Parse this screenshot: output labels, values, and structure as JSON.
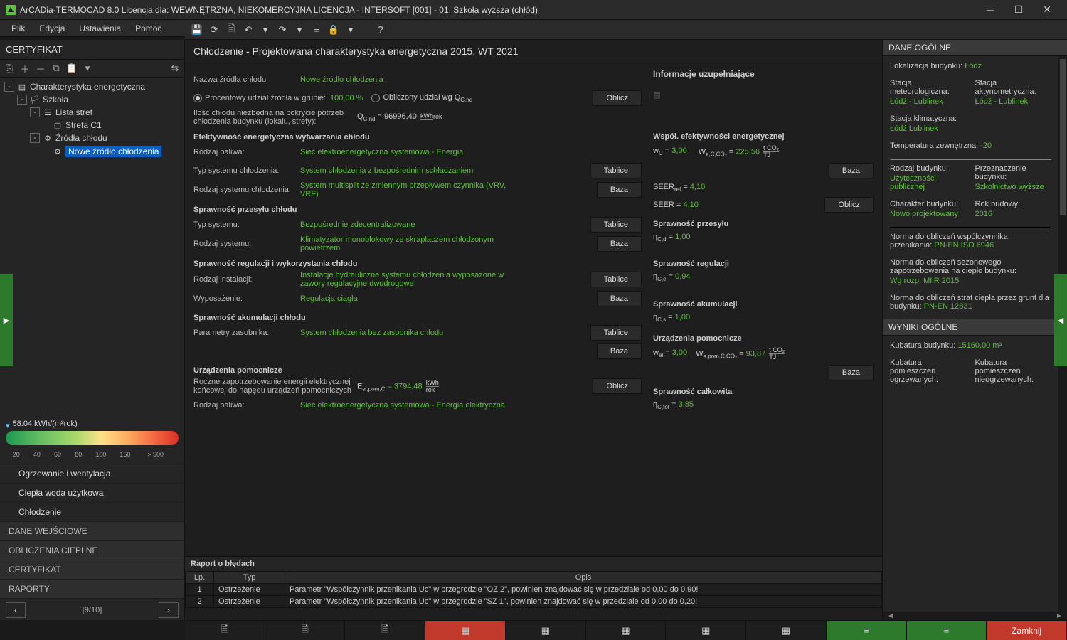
{
  "titlebar": {
    "app_name": "ArCADia-TERMOCAD 8.0 Licencja dla: WEWNĘTRZNA, NIEKOMERCYJNA LICENCJA - INTERSOFT [001] - 01. Szkoła wyższa (chłód)"
  },
  "menu": [
    "Plik",
    "Edycja",
    "Ustawienia",
    "Pomoc"
  ],
  "left": {
    "title": "CERTYFIKAT",
    "tree": {
      "root": "Charakterystyka energetyczna",
      "school": "Szkoła",
      "zones_list": "Lista stref",
      "zone_c1": "Strefa C1",
      "sources": "Źródła chłodu",
      "new_source": "Nowe źródło chłodzenia"
    },
    "gauge_label": "58.04 kWh/(m²rok)",
    "gauge_ticks": [
      20,
      40,
      60,
      80,
      100,
      150,
      "> 500"
    ],
    "nav": {
      "sub1": "Ogrzewanie i wentylacja",
      "sub2": "Ciepła woda użytkowa",
      "sub3": "Chłodzenie",
      "sec1": "DANE WEJŚCIOWE",
      "sec2": "OBLICZENIA CIEPLNE",
      "sec3": "CERTYFIKAT",
      "sec4": "RAPORTY"
    },
    "page": "[9/10]"
  },
  "center": {
    "header": "Chłodzenie - Projektowana charakterystyka energetyczna 2015, WT 2021",
    "name_label": "Nazwa źródła chłodu",
    "name_value": "Nowe źródło chłodzenia",
    "radio_percent_label": "Procentowy udział źródła w grupie:",
    "percent_value": "100,00 %",
    "radio_calc_label": "Obliczony udział wg Q",
    "radio_calc_sub": "C,nd",
    "calc_btn": "Oblicz",
    "demand_label_1": "Ilość chłodu niezbędna na pokrycie potrzeb",
    "demand_label_2": "chłodzenia budynku (lokalu, strefy):",
    "q_formula_left": "Q",
    "q_formula_sub": "C,nd",
    "q_formula_eq": "= 96996,40",
    "q_unit_top": "kWh",
    "q_unit_bot": "rok",
    "eff_heading": "Efektywność energetyczna wytwarzania chłodu",
    "fuel_label": "Rodzaj paliwa:",
    "fuel_value": "Sieć elektroenergetyczna systemowa - Energia",
    "sys_label": "Typ systemu chłodzenia:",
    "sys_value": "System chłodzenia z bezpośrednim schładzaniem",
    "tables_btn": "Tablice",
    "base_btn": "Baza",
    "syskind_label": "Rodzaj systemu chłodzenia:",
    "syskind_value": "System multisplit ze zmiennym przepływem czynnika (VRV, VRF)",
    "trans_heading": "Sprawność przesyłu chłodu",
    "trans_type_label": "Typ systemu:",
    "trans_type_value": "Bezpośrednie zdecentralizowane",
    "trans_kind_label": "Rodzaj systemu:",
    "trans_kind_value": "Klimatyzator monoblokowy ze skraplaczem chłodzonym powietrzem",
    "reg_heading": "Sprawność regulacji i wykorzystania chłodu",
    "inst_label": "Rodzaj instalacji:",
    "inst_value": "Instalacje hydrauliczne systemu chłodzenia wyposażone w zawory regulacyjne dwudrogowe",
    "equip_label": "Wyposażenie:",
    "equip_value": "Regulacja ciągła",
    "acc_heading": "Sprawność akumulacji chłodu",
    "tank_label": "Parametry zasobnika:",
    "tank_value": "System chłodzenia bez zasobnika chłodu",
    "aux_heading": "Urządzenia pomocnicze",
    "aux_l1": "Roczne zapotrzebowanie energii elektrycznej",
    "aux_l2": "końcowej do napędu urządzeń pomocniczych",
    "aux_formula_left": "E",
    "aux_formula_sub": "el,pom,C",
    "aux_formula_eq": "= 3794,48",
    "fuel2_label": "Rodzaj paliwa:",
    "fuel2_value": "Sieć elektroenergetyczna systemowa - Energia elektryczna"
  },
  "right_info": {
    "title": "Informacje uzupełniające",
    "wspol_heading": "Współ. efektywności energetycznej",
    "wc_l": "w",
    "wc_sub": "C",
    "wc_v": "3,00",
    "we_l": "W",
    "we_sub": "e,C,CO₂",
    "we_v": "225,56",
    "we_unit_top": "t CO₂",
    "we_unit_bot": "TJ",
    "seer_ref_l": "SEER",
    "seer_ref_sub": "ref",
    "seer_ref_v": "4,10",
    "seer_l": "SEER =",
    "seer_v": "4,10",
    "trans_heading": "Sprawność przesyłu",
    "ncd_l": "η",
    "ncd_sub": "C,d",
    "ncd_v": "1,00",
    "reg_heading": "Sprawność regulacji",
    "nce_l": "η",
    "nce_sub": "C,e",
    "nce_v": "0,94",
    "acc_heading": "Sprawność akumulacji",
    "ncs_l": "η",
    "ncs_sub": "C,s",
    "ncs_v": "1,00",
    "aux_heading": "Urządzenia pomocnicze",
    "wel_l": "w",
    "wel_sub": "el",
    "wel_v": "3,00",
    "wepom_l": "W",
    "wepom_sub": "e,pom,C,CO₂",
    "wepom_v": "93,87",
    "tot_heading": "Sprawność całkowita",
    "nctot_l": "η",
    "nctot_sub": "C,tot",
    "nctot_v": "3,85"
  },
  "report": {
    "title": "Raport o błędach",
    "cols": [
      "Lp.",
      "Typ",
      "Opis"
    ],
    "rows": [
      {
        "lp": "1",
        "typ": "Ostrzeżenie",
        "opis": "Parametr \"Współczynnik przenikania Uc\" w przegrodzie \"OZ 2\", powinien znajdować się w przedziale od 0,00 do 0,90!"
      },
      {
        "lp": "2",
        "typ": "Ostrzeżenie",
        "opis": "Parametr \"Współczynnik przenikania Uc\" w przegrodzie \"SZ 1\", powinien znajdować się w przedziale od 0,00 do 0,20!"
      }
    ]
  },
  "rpanel": {
    "head1": "DANE OGÓLNE",
    "loc_l": "Lokalizacja budynku:",
    "loc_v": "Łódź",
    "meteo_l": "Stacja meteorologiczna:",
    "meteo_v": "Łódź - Lublinek",
    "aktyno_l": "Stacja aktynometryczna:",
    "aktyno_v": "Łódź - Lublinek",
    "klim_l": "Stacja klimatyczna:",
    "klim_v": "Łódź Lublinek",
    "temp_l": "Temperatura zewnętrzna:",
    "temp_v": "-20",
    "rodz_l": "Rodzaj budynku:",
    "rodz_v": "Użyteczności publicznej",
    "przezn_l": "Przeznaczenie budynku:",
    "przezn_v": "Szkolnictwo wyższe",
    "char_l": "Charakter budynku:",
    "char_v": "Nowo projektowany",
    "rok_l": "Rok budowy:",
    "rok_v": "2016",
    "norm1_l": "Norma do obliczeń współczynnika przenikania:",
    "norm1_v": "PN-EN ISO 6946",
    "norm2_l": "Norma do obliczeń sezonowego zapotrzebowania na ciepło budynku:",
    "norm2_v": "Wg rozp. MIiR 2015",
    "norm3_l": "Norma do obliczeń strat ciepła przez grunt dla budynku:",
    "norm3_v": "PN-EN 12831",
    "head2": "WYNIKI OGÓLNE",
    "kub_l": "Kubatura budynku:",
    "kub_v": "15160,00 m³",
    "kub_og_l": "Kubatura pomieszczeń ogrzewanych:",
    "kub_nog_l": "Kubatura pomieszczeń nieogrzewanych:"
  },
  "bottom": {
    "close": "Zamknij"
  }
}
